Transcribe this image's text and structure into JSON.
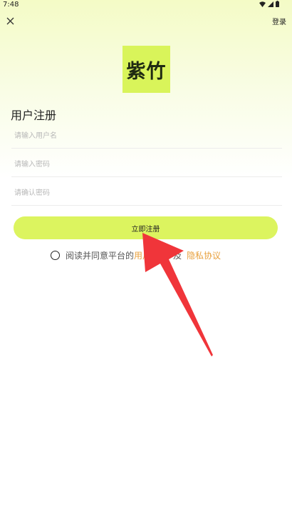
{
  "status_bar": {
    "time": "7:48"
  },
  "header": {
    "login_label": "登录"
  },
  "logo": {
    "text": "紫竹"
  },
  "form": {
    "title": "用户注册",
    "username_placeholder": "请输入用户名",
    "password_placeholder": "请输入密码",
    "confirm_placeholder": "请确认密码",
    "submit_label": "立即注册"
  },
  "agreement": {
    "prefix": "阅读并同意平台的",
    "user_agreement": "用户协议",
    "and": "及",
    "privacy_policy": "隐私协议"
  },
  "colors": {
    "accent": "#dcf45f",
    "link": "#e8a03c",
    "annotation_arrow": "#f0353a"
  }
}
